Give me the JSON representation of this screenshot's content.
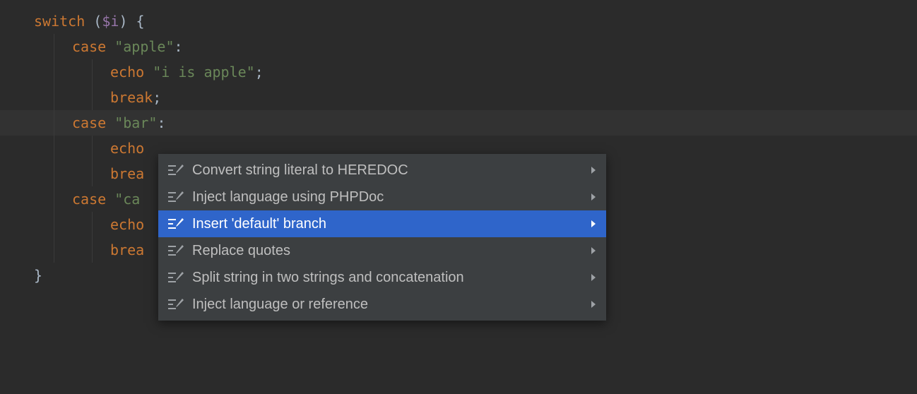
{
  "code": {
    "lines": [
      {
        "indent": 0,
        "highlight": false,
        "tokens": [
          {
            "c": "kw",
            "t": "switch"
          },
          {
            "c": "pun",
            "t": " ("
          },
          {
            "c": "var",
            "t": "$i"
          },
          {
            "c": "pun",
            "t": ") {"
          }
        ]
      },
      {
        "indent": 1,
        "highlight": false,
        "tokens": [
          {
            "c": "kw",
            "t": "case"
          },
          {
            "c": "pun",
            "t": " "
          },
          {
            "c": "str",
            "t": "\"apple\""
          },
          {
            "c": "pun",
            "t": ":"
          }
        ]
      },
      {
        "indent": 2,
        "highlight": false,
        "tokens": [
          {
            "c": "kw",
            "t": "echo"
          },
          {
            "c": "pun",
            "t": " "
          },
          {
            "c": "str",
            "t": "\"i is apple\""
          },
          {
            "c": "pun",
            "t": ";"
          }
        ]
      },
      {
        "indent": 2,
        "highlight": false,
        "tokens": [
          {
            "c": "kw",
            "t": "break"
          },
          {
            "c": "pun",
            "t": ";"
          }
        ]
      },
      {
        "indent": 1,
        "highlight": true,
        "tokens": [
          {
            "c": "kw",
            "t": "case"
          },
          {
            "c": "pun",
            "t": " "
          },
          {
            "c": "str",
            "t": "\"bar\""
          },
          {
            "c": "pun",
            "t": ":"
          }
        ]
      },
      {
        "indent": 2,
        "highlight": false,
        "tokens": [
          {
            "c": "kw",
            "t": "echo"
          }
        ]
      },
      {
        "indent": 2,
        "highlight": false,
        "tokens": [
          {
            "c": "kw",
            "t": "brea"
          }
        ]
      },
      {
        "indent": 1,
        "highlight": false,
        "tokens": [
          {
            "c": "kw",
            "t": "case"
          },
          {
            "c": "pun",
            "t": " "
          },
          {
            "c": "str",
            "t": "\"ca"
          }
        ]
      },
      {
        "indent": 2,
        "highlight": false,
        "tokens": [
          {
            "c": "kw",
            "t": "echo"
          }
        ]
      },
      {
        "indent": 2,
        "highlight": false,
        "tokens": [
          {
            "c": "kw",
            "t": "brea"
          }
        ]
      },
      {
        "indent": 0,
        "highlight": false,
        "tokens": [
          {
            "c": "pun",
            "t": "}"
          }
        ]
      }
    ]
  },
  "menu": {
    "items": [
      {
        "label": "Convert string literal to HEREDOC",
        "selected": false,
        "has_submenu": true
      },
      {
        "label": "Inject language using PHPDoc",
        "selected": false,
        "has_submenu": true
      },
      {
        "label": "Insert 'default' branch",
        "selected": true,
        "has_submenu": true
      },
      {
        "label": "Replace quotes",
        "selected": false,
        "has_submenu": true
      },
      {
        "label": "Split string in two strings and concatenation",
        "selected": false,
        "has_submenu": true
      },
      {
        "label": "Inject language or reference",
        "selected": false,
        "has_submenu": true
      }
    ]
  }
}
